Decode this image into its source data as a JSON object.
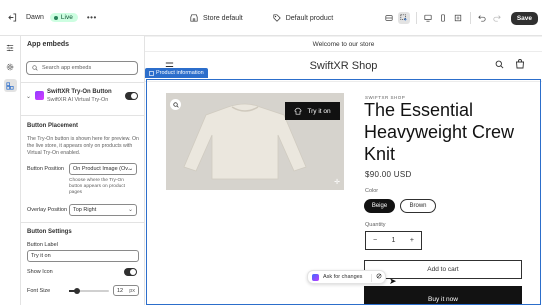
{
  "topbar": {
    "theme_name": "Dawn",
    "status_badge": "Live",
    "more_icon": "ellipsis-icon",
    "template_label": "Store default",
    "product_label": "Default product",
    "save_label": "Save"
  },
  "panel": {
    "title": "App embeds",
    "search_placeholder": "Search app embeds",
    "app": {
      "name": "SwiftXR Try-On Button",
      "subtitle": "SwiftXR AI Virtual Try-On",
      "enabled": true
    },
    "placement": {
      "heading": "Button Placement",
      "description": "The Try-On button is shown here for preview. On the live store, it appears only on products with Virtual Try-On enabled.",
      "position_label": "Button Position",
      "position_value": "On Product Image (Ov...",
      "position_help": "Choose where the Try-On button appears on product pages",
      "overlay_label": "Overlay Position",
      "overlay_value": "Top Right"
    },
    "settings": {
      "heading": "Button Settings",
      "label_label": "Button Label",
      "label_value": "Try it on",
      "show_icon_label": "Show Icon",
      "show_icon": true,
      "font_size_label": "Font Size",
      "font_size_value": "12",
      "font_size_unit": "px",
      "font_size_fraction": 0.2
    }
  },
  "preview": {
    "announcement": "Welcome to our store",
    "brand": "SwiftXR Shop",
    "section_tab": "Product information",
    "tryon_label": "Try it on",
    "vendor": "SWIFTXR SHOP",
    "title": "The Essential Heavyweight Crew Knit",
    "price": "$90.00 USD",
    "color_label": "Color",
    "colors": [
      "Beige",
      "Brown"
    ],
    "selected_color": "Beige",
    "quantity_label": "Quantity",
    "quantity_value": "1",
    "qty_minus": "−",
    "qty_plus": "+",
    "add_to_cart": "Add to cart",
    "buy_now": "Buy it now",
    "ask_label": "Ask for changes"
  },
  "colors": {
    "accent": "#2c6ecb",
    "live_badge_bg": "#cdfee1",
    "primary_dark": "#303030"
  }
}
